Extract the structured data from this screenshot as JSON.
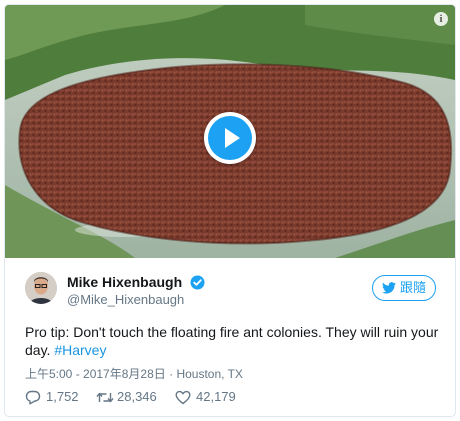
{
  "tweet": {
    "display_name": "Mike Hixenbaugh",
    "username": "@Mike_Hixenbaugh",
    "follow_label": "跟隨",
    "text": "Pro tip: Don't touch the floating fire ant colonies. They will ruin your day.",
    "hashtag": "#Harvey",
    "timestamp": "上午5:00 - 2017年8月28日",
    "location": "Houston, TX",
    "separator": "·",
    "replies": "1,752",
    "retweets": "28,346",
    "likes": "42,179"
  },
  "media": {
    "info_icon": "i",
    "play_icon": "play-icon"
  },
  "colors": {
    "accent": "#1da1f2",
    "hashtag": "#1b95e0",
    "secondary_text": "#657786"
  }
}
